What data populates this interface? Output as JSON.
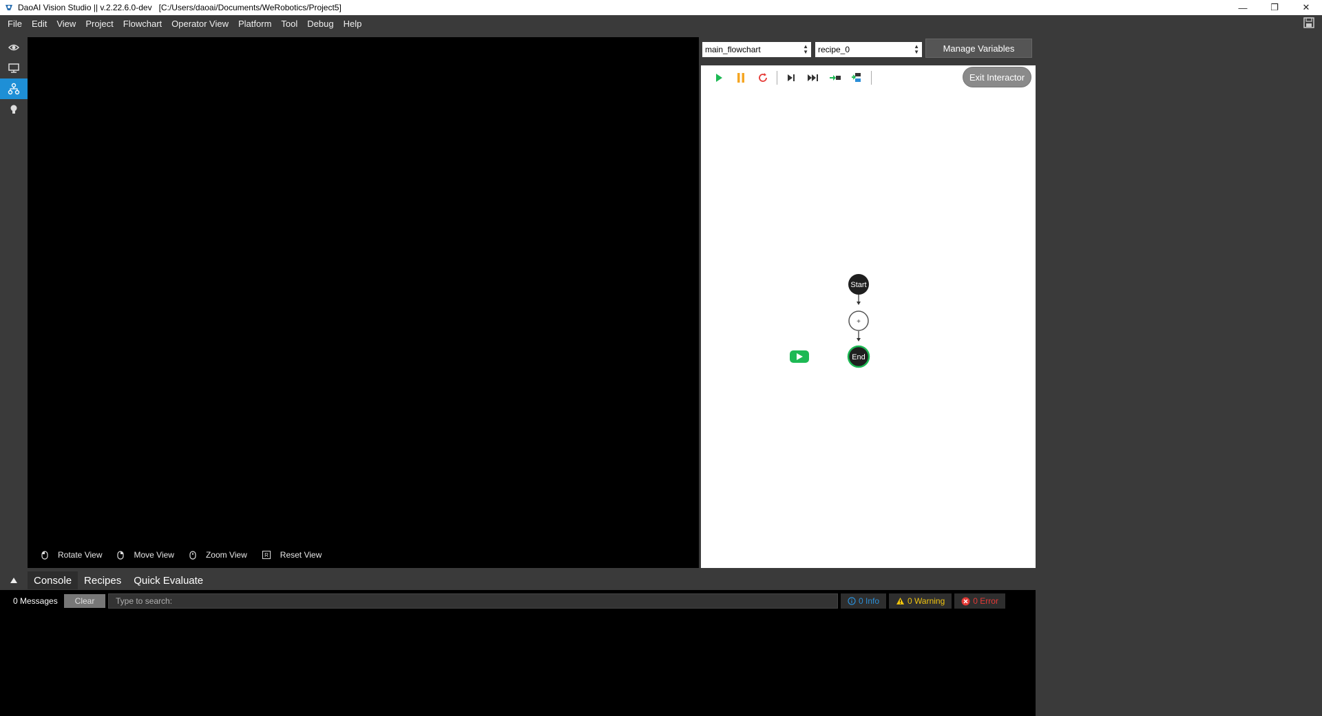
{
  "titlebar": {
    "title": "DaoAI Vision Studio || v.2.22.6.0-dev   [C:/Users/daoai/Documents/WeRobotics/Project5]"
  },
  "menu": [
    "File",
    "Edit",
    "View",
    "Project",
    "Flowchart",
    "Operator View",
    "Platform",
    "Tool",
    "Debug",
    "Help"
  ],
  "toolstrip": {
    "items": [
      "eye-icon",
      "monitor-icon",
      "flowchart-icon",
      "lightbulb-icon"
    ],
    "active_index": 2,
    "accent": "#1e8fd6"
  },
  "viewer": {
    "hints": [
      {
        "icon": "mouse-left-icon",
        "label": "Rotate View"
      },
      {
        "icon": "mouse-right-icon",
        "label": "Move View"
      },
      {
        "icon": "mouse-wheel-icon",
        "label": "Zoom View"
      },
      {
        "icon": "r-key-icon",
        "label": "Reset View"
      }
    ]
  },
  "flowchart_select": {
    "value": "main_flowchart"
  },
  "recipe_select": {
    "value": "recipe_0"
  },
  "manage_variables_label": "Manage Variables",
  "exit_interactor_label": "Exit Interactor",
  "flow_toolbar": [
    "play-icon",
    "pause-icon",
    "restart-icon",
    "step-icon",
    "fast-forward-icon",
    "step-into-icon",
    "debug-icon"
  ],
  "flowchart": {
    "start_label": "Start",
    "end_label": "End",
    "add_label": "+",
    "colors": {
      "node": "#1f1f1f",
      "end_ring": "#1db954",
      "play_badge": "#1db954"
    }
  },
  "bottom_tabs": [
    "Console",
    "Recipes",
    "Quick Evaluate"
  ],
  "console": {
    "message_count": "0 Messages",
    "clear_label": "Clear",
    "search_placeholder": "Type to search:",
    "info": "0 Info",
    "warning": "0 Warning",
    "error": "0 Error",
    "colors": {
      "info": "#2a8fd8",
      "warning": "#f1c40f",
      "error": "#e53935"
    }
  }
}
